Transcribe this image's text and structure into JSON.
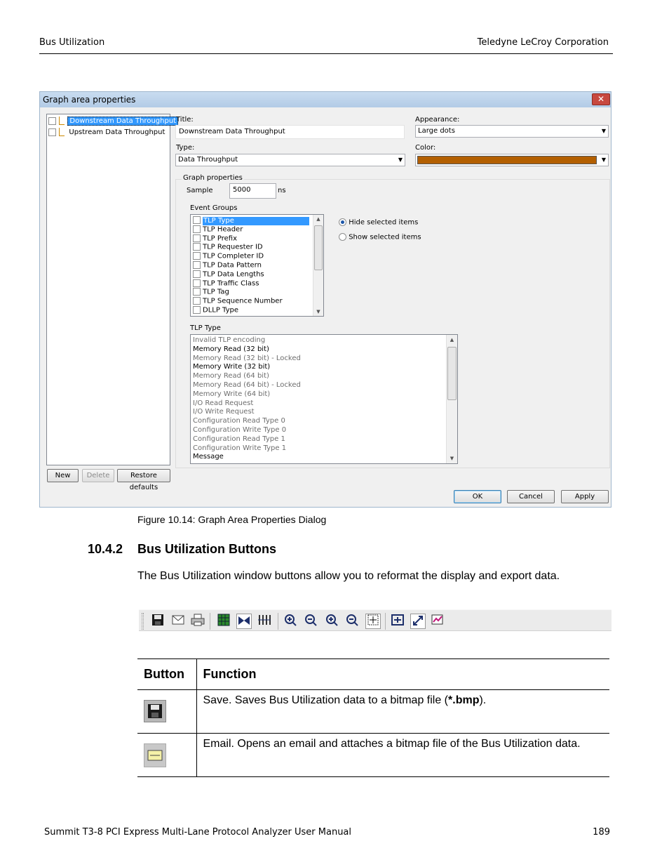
{
  "page_header": {
    "left": "Bus Utilization",
    "right": "Teledyne LeCroy Corporation"
  },
  "dialog": {
    "title": "Graph area properties",
    "close_glyph": "✕",
    "graph_list": [
      "Downstream Data Throughput",
      "Upstream Data Throughput"
    ],
    "left_buttons": {
      "new": "New",
      "delete": "Delete",
      "restore": "Restore defaults"
    },
    "title_label": "Title:",
    "title_value": "Downstream Data Throughput",
    "appearance_label": "Appearance:",
    "appearance_value": "Large dots",
    "type_label": "Type:",
    "type_value": "Data Throughput",
    "color_label": "Color:",
    "color_value": "#b35f00",
    "graph_properties_label": "Graph properties",
    "sample_label": "Sample",
    "sample_value": "5000",
    "sample_unit": "ns",
    "event_groups_label": "Event Groups",
    "event_groups": [
      "TLP Type",
      "TLP Header",
      "TLP Prefix",
      "TLP Requester ID",
      "TLP Completer ID",
      "TLP Data Pattern",
      "TLP Data Lengths",
      "TLP Traffic Class",
      "TLP Tag",
      "TLP Sequence Number",
      "DLLP Type"
    ],
    "hide_label": "Hide selected items",
    "show_label": "Show selected items",
    "tlp_type_label": "TLP Type",
    "tlp_types": [
      {
        "text": "Invalid TLP encoding",
        "dim": true
      },
      {
        "text": "Memory Read (32 bit)",
        "dim": false
      },
      {
        "text": "Memory Read (32 bit) - Locked",
        "dim": true
      },
      {
        "text": "Memory Write (32 bit)",
        "dim": false
      },
      {
        "text": "Memory Read (64 bit)",
        "dim": true
      },
      {
        "text": "Memory Read (64 bit) - Locked",
        "dim": true
      },
      {
        "text": "Memory Write (64 bit)",
        "dim": true
      },
      {
        "text": "I/O Read Request",
        "dim": true
      },
      {
        "text": "I/O Write Request",
        "dim": true
      },
      {
        "text": "Configuration Read Type 0",
        "dim": true
      },
      {
        "text": "Configuration Write Type 0",
        "dim": true
      },
      {
        "text": "Configuration Read Type 1",
        "dim": true
      },
      {
        "text": "Configuration Write Type 1",
        "dim": true
      },
      {
        "text": "Message",
        "dim": false
      }
    ],
    "ok": "OK",
    "cancel": "Cancel",
    "apply": "Apply"
  },
  "caption": "Figure 10.14:  Graph Area Properties Dialog",
  "section": {
    "number": "10.4.2",
    "title": "Bus Utilization Buttons"
  },
  "intro": "The Bus Utilization window buttons allow you to reformat the display and export data.",
  "toolbar_icons": [
    "save-icon",
    "email-icon",
    "print-icon",
    "grid-icon",
    "bowtie-icon",
    "columns-icon",
    "zoom-in-horizontal-icon",
    "zoom-out-horizontal-icon",
    "zoom-in-vertical-icon",
    "zoom-out-vertical-icon",
    "crosshair-icon",
    "fit-icon",
    "expand-icon",
    "graph-properties-icon"
  ],
  "table": {
    "headers": [
      "Button",
      "Function"
    ],
    "rows": [
      {
        "icon": "save-icon",
        "text_pre": "Save. Saves Bus Utilization data to a bitmap file (",
        "text_bold": "*.bmp",
        "text_post": ")."
      },
      {
        "icon": "email-icon",
        "text_pre": "Email. Opens an email and attaches a bitmap file of the Bus Utilization data.",
        "text_bold": "",
        "text_post": ""
      }
    ]
  },
  "footer": {
    "left": "Summit T3-8 PCI Express Multi-Lane Protocol Analyzer User Manual",
    "right": "189"
  }
}
